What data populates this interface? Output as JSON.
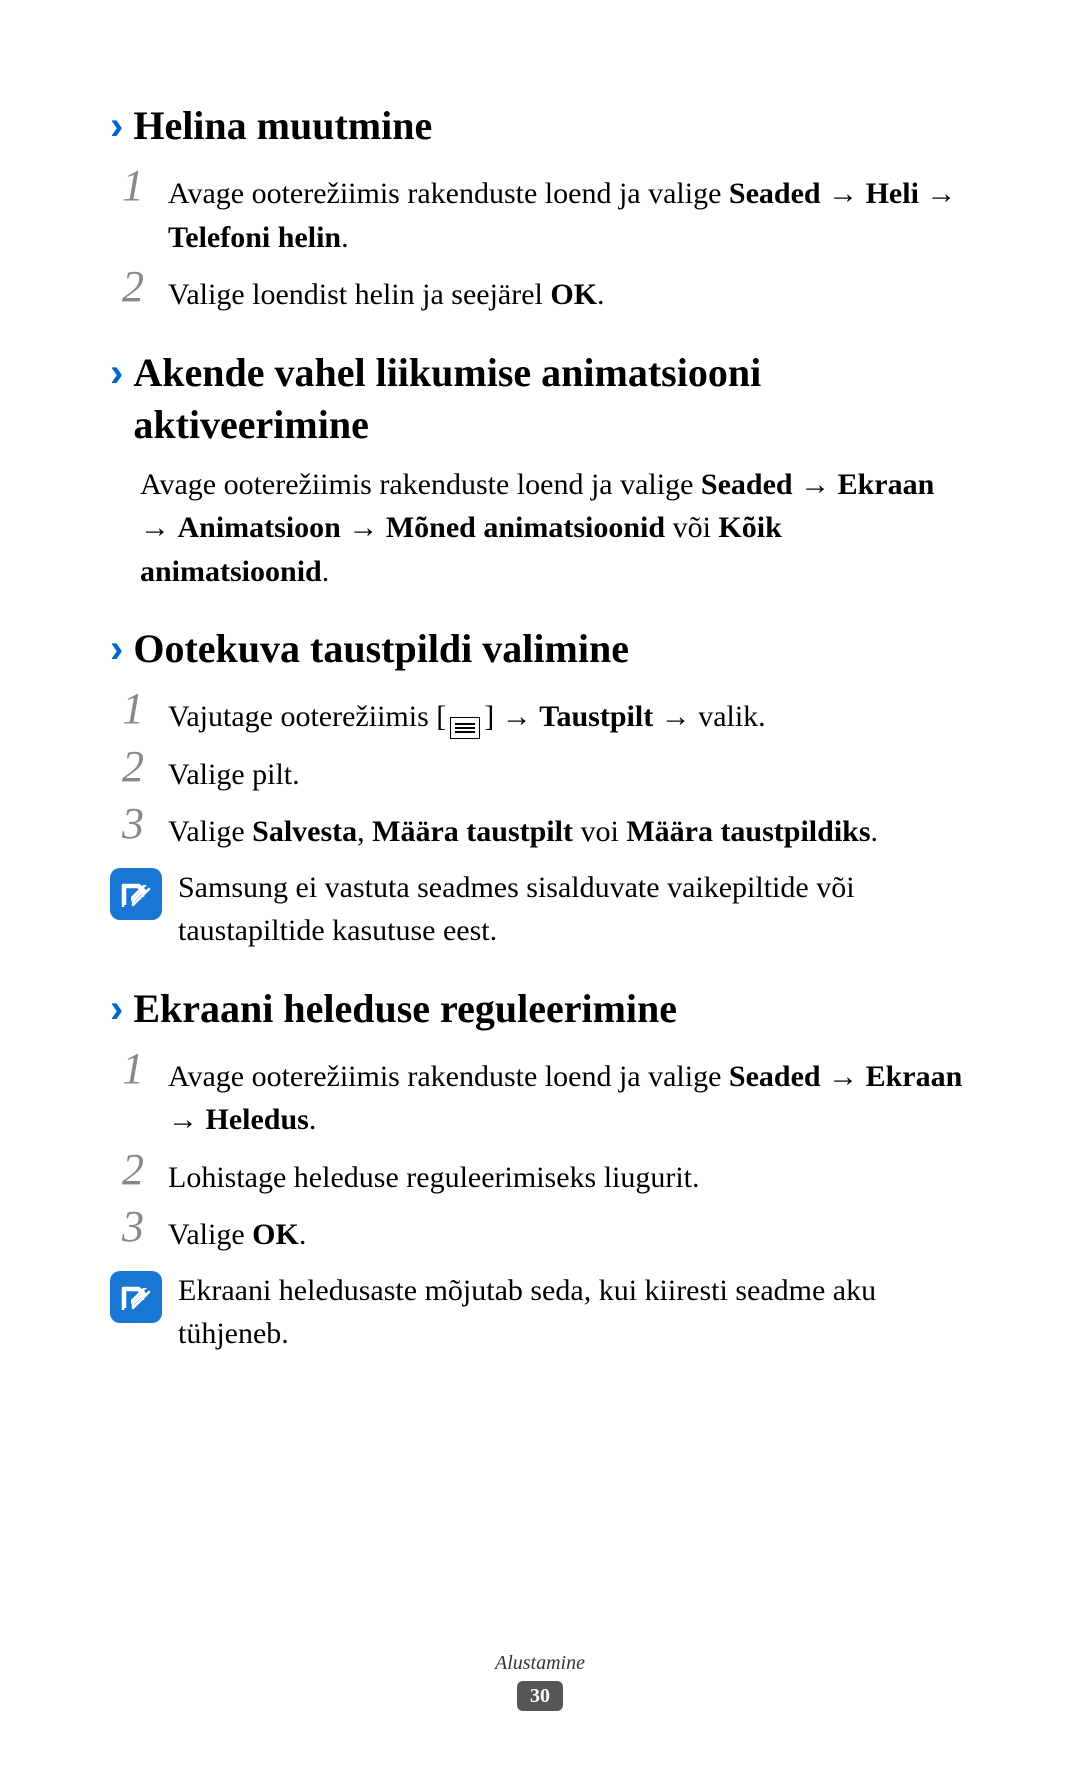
{
  "sections": [
    {
      "heading": "Helina muutmine",
      "steps": [
        {
          "num": "1",
          "parts": [
            {
              "t": "Avage ooterežiimis rakenduste loend ja valige ",
              "b": false
            },
            {
              "t": "Seaded",
              "b": true
            },
            {
              "t": " → ",
              "b": false
            },
            {
              "t": "Heli",
              "b": true
            },
            {
              "t": " → ",
              "b": false
            },
            {
              "t": "Telefoni helin",
              "b": true
            },
            {
              "t": ".",
              "b": false
            }
          ]
        },
        {
          "num": "2",
          "parts": [
            {
              "t": "Valige loendist helin ja seejärel ",
              "b": false
            },
            {
              "t": "OK",
              "b": true
            },
            {
              "t": ".",
              "b": false
            }
          ]
        }
      ]
    },
    {
      "heading": "Akende vahel liikumise animatsiooni aktiveerimine",
      "body_parts": [
        {
          "t": "Avage ooterežiimis rakenduste loend ja valige ",
          "b": false
        },
        {
          "t": "Seaded",
          "b": true
        },
        {
          "t": " → ",
          "b": false
        },
        {
          "t": "Ekraan",
          "b": true
        },
        {
          "t": " → ",
          "b": false
        },
        {
          "t": "Animatsioon",
          "b": true
        },
        {
          "t": " → ",
          "b": false
        },
        {
          "t": "Mõned animatsioonid",
          "b": true
        },
        {
          "t": " või ",
          "b": false
        },
        {
          "t": "Kõik animatsioonid",
          "b": true
        },
        {
          "t": ".",
          "b": false
        }
      ]
    },
    {
      "heading": "Ootekuva taustpildi valimine",
      "steps": [
        {
          "num": "1",
          "parts_special": "wallpaper_step1"
        },
        {
          "num": "2",
          "parts": [
            {
              "t": "Valige pilt.",
              "b": false
            }
          ]
        },
        {
          "num": "3",
          "parts": [
            {
              "t": "Valige ",
              "b": false
            },
            {
              "t": "Salvesta",
              "b": true
            },
            {
              "t": ", ",
              "b": false
            },
            {
              "t": "Määra taustpilt",
              "b": true
            },
            {
              "t": " voi ",
              "b": false
            },
            {
              "t": "Määra taustpildiks",
              "b": true
            },
            {
              "t": ".",
              "b": false
            }
          ]
        }
      ],
      "note": "Samsung ei vastuta seadmes sisalduvate vaikepiltide või taustapiltide kasutuse eest."
    },
    {
      "heading": "Ekraani heleduse reguleerimine",
      "steps": [
        {
          "num": "1",
          "parts": [
            {
              "t": "Avage ooterežiimis rakenduste loend ja valige ",
              "b": false
            },
            {
              "t": "Seaded",
              "b": true
            },
            {
              "t": " → ",
              "b": false
            },
            {
              "t": "Ekraan",
              "b": true
            },
            {
              "t": " → ",
              "b": false
            },
            {
              "t": "Heledus",
              "b": true
            },
            {
              "t": ".",
              "b": false
            }
          ]
        },
        {
          "num": "2",
          "parts": [
            {
              "t": "Lohistage heleduse reguleerimiseks liugurit.",
              "b": false
            }
          ]
        },
        {
          "num": "3",
          "parts": [
            {
              "t": "Valige ",
              "b": false
            },
            {
              "t": "OK",
              "b": true
            },
            {
              "t": ".",
              "b": false
            }
          ]
        }
      ],
      "note": "Ekraani heledusaste mõjutab seda, kui kiiresti seadme aku tühjeneb."
    }
  ],
  "special": {
    "wallpaper_step1_prefix": "Vajutage ooterežiimis [",
    "wallpaper_step1_mid1": "] → ",
    "wallpaper_step1_bold": "Taustpilt",
    "wallpaper_step1_mid2": " → valik."
  },
  "footer": {
    "label": "Alustamine",
    "page": "30"
  }
}
